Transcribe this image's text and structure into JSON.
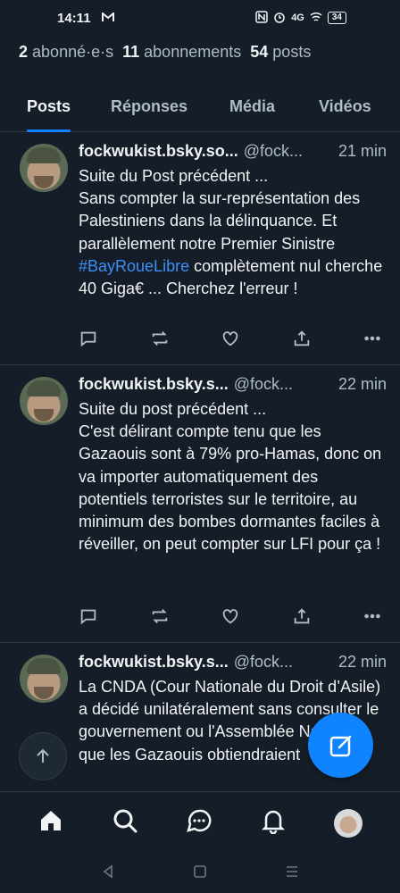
{
  "status_bar": {
    "time": "14:11",
    "mail_icon": "gmail-icon",
    "signal_text": "4G",
    "battery": "34"
  },
  "profile_stats": {
    "followers_count": "2",
    "followers_label": "abonné·e·s",
    "following_count": "11",
    "following_label": "abonnements",
    "posts_count": "54",
    "posts_label": "posts"
  },
  "tabs": [
    {
      "label": "Posts",
      "active": true
    },
    {
      "label": "Réponses",
      "active": false
    },
    {
      "label": "Média",
      "active": false
    },
    {
      "label": "Vidéos",
      "active": false
    }
  ],
  "posts": [
    {
      "name": "fockwukist.bsky.so...",
      "handle": "@fock...",
      "time": "21 min",
      "text_before": "Suite du Post précédent ...\nSans compter la sur-représentation des Palestiniens dans la délinquance. Et parallèlement notre Premier Sinistre ",
      "hashtag": "#BayRoueLibre",
      "text_after": " complètement nul cherche 40 Giga€ ... Cherchez l'erreur !"
    },
    {
      "name": "fockwukist.bsky.s...",
      "handle": "@fock...",
      "time": "22 min",
      "text_before": "Suite du post précédent ...\nC'est délirant compte tenu que les Gazaouis sont à 79% pro-Hamas, donc on va importer automatiquement des potentiels terroristes sur le territoire, au minimum des bombes dormantes faciles à réveiller, on peut compter sur LFI pour ça !",
      "hashtag": "",
      "text_after": ""
    },
    {
      "name": "fockwukist.bsky.s...",
      "handle": "@fock...",
      "time": "22 min",
      "text_before": "La CNDA (Cour Nationale du Droit d’Asile) a décidé unilatéralement sans consulter le gouvernement ou l'Assemblée Nationale, que les Gazaouis obtiendraient",
      "hashtag": "",
      "text_after": ""
    }
  ],
  "action_icons": [
    "reply-icon",
    "repost-icon",
    "like-icon",
    "share-icon",
    "more-icon"
  ],
  "bottom_nav": [
    "home-icon",
    "search-icon",
    "chat-icon",
    "notifications-icon",
    "profile-avatar"
  ],
  "colors": {
    "background": "#151e28",
    "accent": "#1083fe",
    "muted": "#aebbc9",
    "divider": "#2e3a47"
  }
}
